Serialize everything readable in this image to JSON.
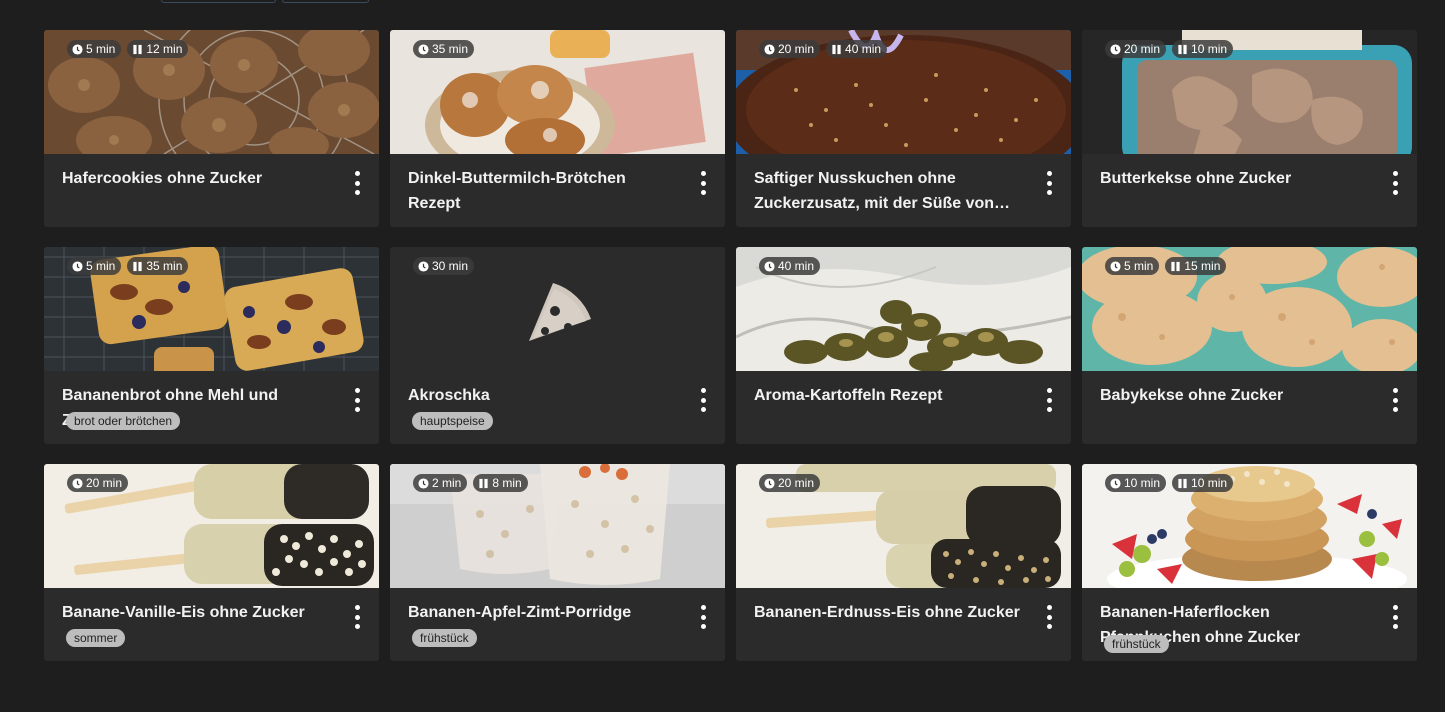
{
  "recipes": [
    {
      "title": "Hafercookies ohne Zucker",
      "badges": [
        {
          "kind": "clock",
          "text": "5 min"
        },
        {
          "kind": "pause",
          "text": "12 min"
        }
      ],
      "tag": ""
    },
    {
      "title": "Dinkel-Buttermilch-Brötchen Rezept",
      "badges": [
        {
          "kind": "clock",
          "text": "35 min"
        }
      ],
      "tag": ""
    },
    {
      "title": "Saftiger Nusskuchen ohne Zuckerzusatz, mit der Süße von…",
      "badges": [
        {
          "kind": "clock",
          "text": "20 min"
        },
        {
          "kind": "pause",
          "text": "40 min"
        }
      ],
      "tag": ""
    },
    {
      "title": "Butterkekse ohne Zucker",
      "badges": [
        {
          "kind": "clock",
          "text": "20 min"
        },
        {
          "kind": "pause",
          "text": "10 min"
        }
      ],
      "tag": ""
    },
    {
      "title": "Bananenbrot ohne Mehl und Zucker",
      "badges": [
        {
          "kind": "clock",
          "text": "5 min"
        },
        {
          "kind": "pause",
          "text": "35 min"
        }
      ],
      "tag": "brot oder brötchen"
    },
    {
      "title": "Akroschka",
      "badges": [
        {
          "kind": "clock",
          "text": "30 min"
        }
      ],
      "tag": "hauptspeise"
    },
    {
      "title": "Aroma-Kartoffeln Rezept",
      "badges": [
        {
          "kind": "clock",
          "text": "40 min"
        }
      ],
      "tag": ""
    },
    {
      "title": "Babykekse ohne Zucker",
      "badges": [
        {
          "kind": "clock",
          "text": "5 min"
        },
        {
          "kind": "pause",
          "text": "15 min"
        }
      ],
      "tag": ""
    },
    {
      "title": "Banane-Vanille-Eis ohne Zucker",
      "badges": [
        {
          "kind": "clock",
          "text": "20 min"
        }
      ],
      "tag": "sommer"
    },
    {
      "title": "Bananen-Apfel-Zimt-Porridge",
      "badges": [
        {
          "kind": "clock",
          "text": "2 min"
        },
        {
          "kind": "pause",
          "text": "8 min"
        }
      ],
      "tag": "frühstück"
    },
    {
      "title": "Bananen-Erdnuss-Eis ohne Zucker",
      "badges": [
        {
          "kind": "clock",
          "text": "20 min"
        }
      ],
      "tag": ""
    },
    {
      "title": "Bananen-Haferflocken Pfannkuchen ohne Zucker",
      "badges": [
        {
          "kind": "clock",
          "text": "10 min"
        },
        {
          "kind": "pause",
          "text": "10 min"
        }
      ],
      "tag": "frühstück"
    }
  ],
  "colors": {
    "background": "#1e1e1e",
    "card": "#2b2b2b",
    "badge": "#3c3c3c",
    "tag": "#bdbdbd"
  }
}
